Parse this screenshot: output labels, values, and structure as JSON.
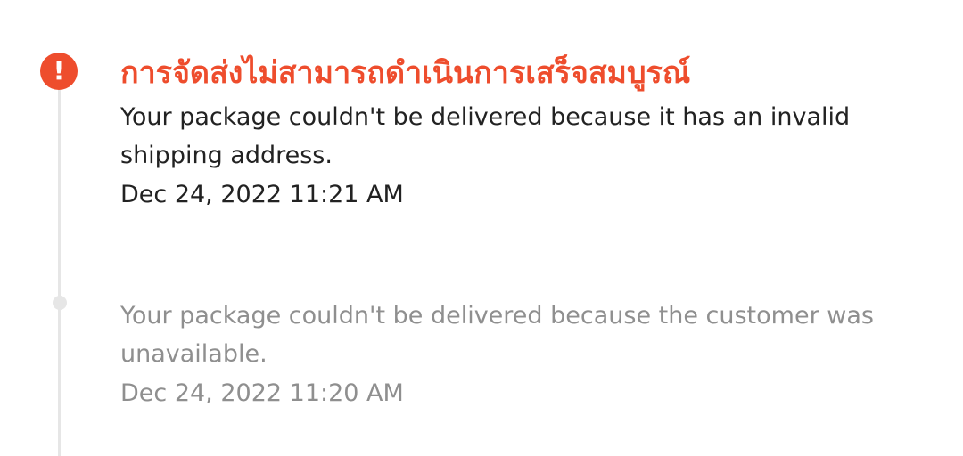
{
  "theme": {
    "accent": "#ee4d2d",
    "line": "#e6e6e6",
    "text_active": "#222222",
    "text_inactive": "#8f8f8f"
  },
  "events": [
    {
      "status_title": "การจัดส่งไม่สามารถดำเนินการเสร็จสมบูรณ์",
      "description": "Your package couldn't be delivered because it has an invalid shipping address.",
      "timestamp": "Dec 24, 2022 11:21 AM",
      "icon": "alert-icon"
    },
    {
      "description": "Your package couldn't be delivered because the customer was unavailable.",
      "timestamp": "Dec 24, 2022 11:20 AM",
      "icon": "dot-icon"
    }
  ]
}
